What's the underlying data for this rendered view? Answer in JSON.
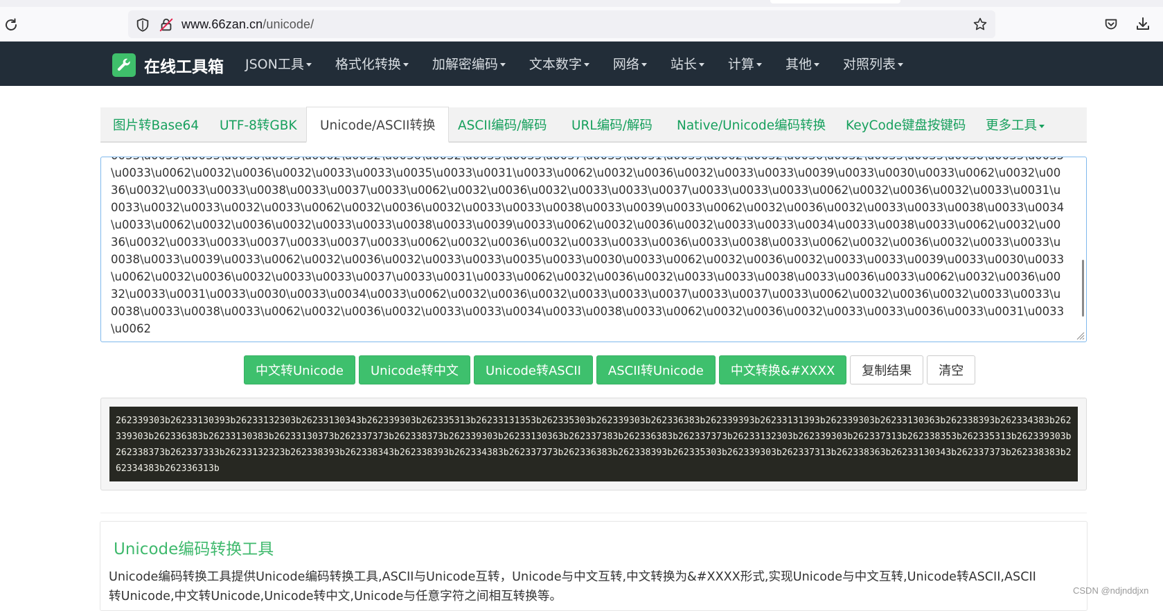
{
  "browser": {
    "url_host": "www.66zan.cn",
    "url_path": "/unicode/"
  },
  "site": {
    "brand": "在线工具箱",
    "nav": [
      {
        "label": "JSON工具"
      },
      {
        "label": "格式化转换"
      },
      {
        "label": "加解密编码"
      },
      {
        "label": "文本数字"
      },
      {
        "label": "网络"
      },
      {
        "label": "站长"
      },
      {
        "label": "计算"
      },
      {
        "label": "其他"
      },
      {
        "label": "对照列表"
      }
    ]
  },
  "tabs": {
    "items": [
      "图片转Base64",
      "UTF-8转GBK",
      "Unicode/ASCII转换",
      "ASCII编码/解码",
      "URL编码/解码",
      "Native/Unicode编码转换",
      "KeyCode键盘按键码",
      "更多工具"
    ],
    "active": "Unicode/ASCII转换"
  },
  "editor": {
    "value": "0033\\u0039\\u0033\\u0030\\u0033\\u0062\\u0032\\u0036\\u0032\\u0033\\u0033\\u0037\\u0033\\u0031\\u0033\\u0062\\u0032\\u0036\\u0032\\u0033\\u0033\\u0038\\u0033\\u0035\\u0033\\u0062\\u0032\\u0036\\u0032\\u0033\\u0033\\u0035\\u0033\\u0031\\u0033\\u0062\\u0032\\u0036\\u0032\\u0033\\u0033\\u0039\\u0033\\u0030\\u0033\\u0062\\u0032\\u0036\\u0032\\u0033\\u0033\\u0038\\u0033\\u0037\\u0033\\u0062\\u0032\\u0036\\u0032\\u0033\\u0033\\u0037\\u0033\\u0033\\u0033\\u0062\\u0032\\u0036\\u0032\\u0033\\u0031\\u0033\\u0032\\u0033\\u0032\\u0033\\u0062\\u0032\\u0036\\u0032\\u0033\\u0033\\u0038\\u0033\\u0039\\u0033\\u0062\\u0032\\u0036\\u0032\\u0033\\u0033\\u0038\\u0033\\u0034\\u0033\\u0062\\u0032\\u0036\\u0032\\u0033\\u0033\\u0038\\u0033\\u0039\\u0033\\u0062\\u0032\\u0036\\u0032\\u0033\\u0033\\u0034\\u0033\\u0038\\u0033\\u0062\\u0032\\u0036\\u0032\\u0033\\u0033\\u0037\\u0033\\u0037\\u0033\\u0062\\u0032\\u0036\\u0032\\u0033\\u0033\\u0036\\u0033\\u0038\\u0033\\u0062\\u0032\\u0036\\u0032\\u0033\\u0033\\u0038\\u0033\\u0039\\u0033\\u0062\\u0032\\u0036\\u0032\\u0033\\u0033\\u0035\\u0033\\u0030\\u0033\\u0062\\u0032\\u0036\\u0032\\u0033\\u0033\\u0039\\u0033\\u0030\\u0033\\u0062\\u0032\\u0036\\u0032\\u0033\\u0033\\u0037\\u0033\\u0031\\u0033\\u0062\\u0032\\u0036\\u0032\\u0033\\u0033\\u0038\\u0033\\u0036\\u0033\\u0062\\u0032\\u0036\\u0032\\u0033\\u0031\\u0033\\u0030\\u0033\\u0034\\u0033\\u0062\\u0032\\u0036\\u0032\\u0033\\u0033\\u0037\\u0033\\u0037\\u0033\\u0062\\u0032\\u0036\\u0032\\u0033\\u0033\\u0038\\u0033\\u0038\\u0033\\u0062\\u0032\\u0036\\u0032\\u0033\\u0033\\u0034\\u0033\\u0038\\u0033\\u0062\\u0032\\u0036\\u0032\\u0033\\u0033\\u0036\\u0033\\u0031\\u0033\\u0062"
  },
  "buttons": {
    "items": [
      {
        "label": "中文转Unicode",
        "style": "green"
      },
      {
        "label": "Unicode转中文",
        "style": "green"
      },
      {
        "label": "Unicode转ASCII",
        "style": "green"
      },
      {
        "label": "ASCII转Unicode",
        "style": "green"
      },
      {
        "label": "中文转换&#XXXX",
        "style": "green"
      },
      {
        "label": "复制结果",
        "style": "plain"
      },
      {
        "label": "清空",
        "style": "plain"
      }
    ]
  },
  "result": {
    "text": "262339303b26233130393b26233132303b26233130343b262339303b262335313b26233131353b262335303b262339303b262336383b262339393b26233131393b262339303b26233130363b262338393b262334383b262339303b262336383b26233130383b26233130373b262337373b262338373b262339303b26233130363b262337383b262336383b262337373b26233132303b262339303b262337313b262338353b262335313b262339303b262338373b262337333b26233132323b262338393b262338343b262338393b262334383b262337373b262336383b262338393b262335303b262339303b262337313b262338363b26233130343b262337373b262338383b262334383b262336313b"
  },
  "info": {
    "title": "Unicode编码转换工具",
    "description": "Unicode编码转换工具提供Unicode编码转换工具,ASCII与Unicode互转，Unicode与中文互转,中文转换为&#XXXX形式,实现Unicode与中文互转,Unicode转ASCII,ASCII转Unicode,中文转Unicode,Unicode转中文,Unicode与任意字符之间相互转换等。"
  },
  "watermark": "CSDN @ndjnddjxn",
  "colors": {
    "navbar_bg": "#222d38",
    "accent_green": "#3ec06d",
    "link_green": "#17a05d",
    "result_bg": "#272822"
  }
}
